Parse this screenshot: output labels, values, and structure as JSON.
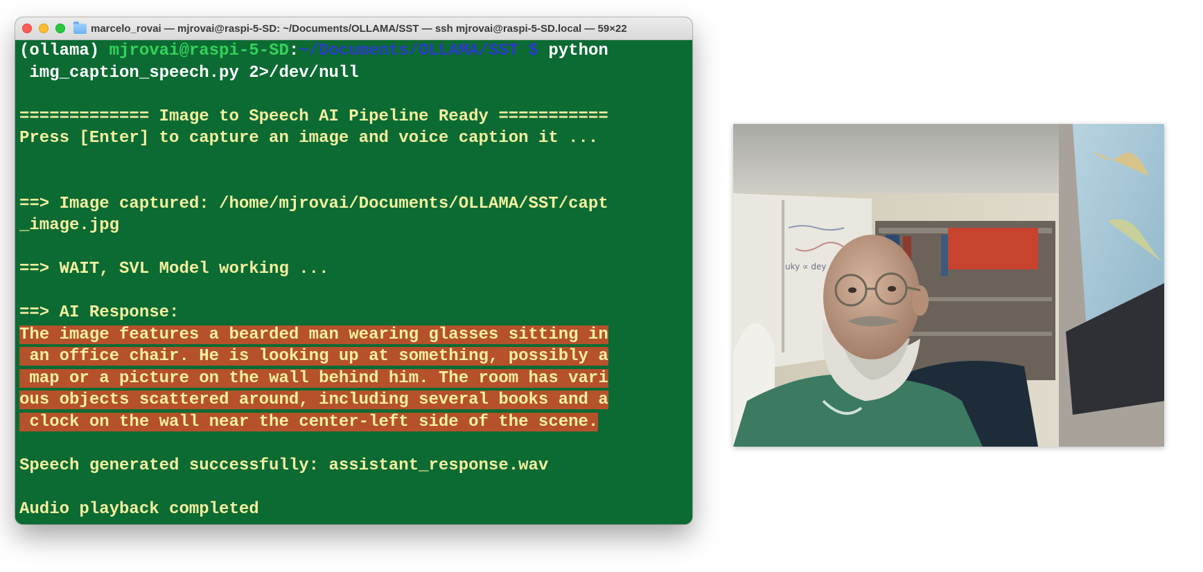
{
  "window": {
    "title": "marcelo_rovai — mjrovai@raspi-5-SD: ~/Documents/OLLAMA/SST — ssh mjrovai@raspi-5-SD.local — 59×22"
  },
  "terminal": {
    "prompt": {
      "env": "(ollama) ",
      "userhost": "mjrovai@raspi-5-SD",
      "colon": ":",
      "path": "~/Documents/OLLAMA/SST",
      "dollar": " $ ",
      "cmd": "python",
      "cmd_cont": " img_caption_speech.py 2>/dev/null"
    },
    "banner": "============= Image to Speech AI Pipeline Ready ===========",
    "instruction": "Press [Enter] to capture an image and voice caption it ...",
    "captured_1": "==> Image captured: /home/mjrovai/Documents/OLLAMA/SST/capt",
    "captured_2": "_image.jpg",
    "wait": "==> WAIT, SVL Model working ...",
    "response_label": "==> AI Response:",
    "response_lines": [
      "The image features a bearded man wearing glasses sitting in",
      " an office chair. He is looking up at something, possibly a",
      " map or a picture on the wall behind him. The room has vari",
      "ous objects scattered around, including several books and a",
      " clock on the wall near the center-left side of the scene."
    ],
    "speech": "Speech generated successfully: assistant_response.wav",
    "audio": "Audio playback completed"
  },
  "colors": {
    "terminal_bg": "#0b6b33",
    "text": "#f4f0a0",
    "userhost": "#34d35a",
    "path": "#2a39c8",
    "highlight": "#b5512b"
  },
  "photo": {
    "subject": "captured webcam image"
  }
}
